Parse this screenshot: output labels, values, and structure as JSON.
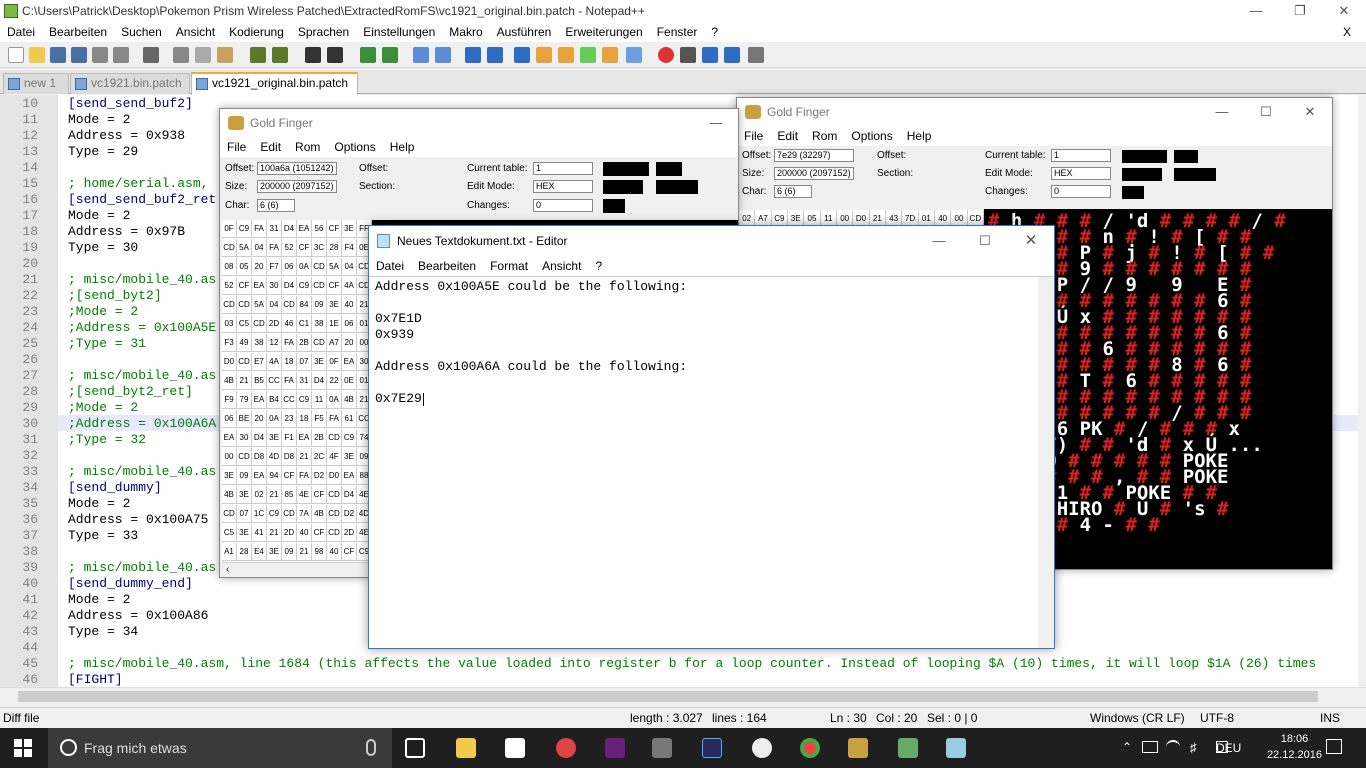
{
  "npp": {
    "title": "C:\\Users\\Patrick\\Desktop\\Pokemon Prism Wireless Patched\\ExtractedRomFS\\vc1921_original.bin.patch - Notepad++",
    "menu": [
      "Datei",
      "Bearbeiten",
      "Suchen",
      "Ansicht",
      "Kodierung",
      "Sprachen",
      "Einstellungen",
      "Makro",
      "Ausführen",
      "Erweiterungen",
      "Fenster",
      "?"
    ],
    "menu_close": "X",
    "tabs": [
      {
        "label": "new 1",
        "active": false
      },
      {
        "label": "vc1921.bin.patch",
        "active": false
      },
      {
        "label": "vc1921_original.bin.patch",
        "active": true
      }
    ],
    "lines": [
      {
        "n": "10",
        "t": "[send_send_buf2]",
        "k": "s"
      },
      {
        "n": "11",
        "t": "Mode = 2",
        "k": ""
      },
      {
        "n": "12",
        "t": "Address = 0x938",
        "k": ""
      },
      {
        "n": "13",
        "t": "Type = 29",
        "k": ""
      },
      {
        "n": "14",
        "t": "",
        "k": ""
      },
      {
        "n": "15",
        "t": "; home/serial.asm,",
        "k": "c"
      },
      {
        "n": "16",
        "t": "[send_send_buf2_ret",
        "k": "s"
      },
      {
        "n": "17",
        "t": "Mode = 2",
        "k": ""
      },
      {
        "n": "18",
        "t": "Address = 0x97B",
        "k": ""
      },
      {
        "n": "19",
        "t": "Type = 30",
        "k": ""
      },
      {
        "n": "20",
        "t": "",
        "k": ""
      },
      {
        "n": "21",
        "t": "; misc/mobile_40.as",
        "k": "c"
      },
      {
        "n": "22",
        "t": ";[send_byt2]",
        "k": "c"
      },
      {
        "n": "23",
        "t": ";Mode = 2",
        "k": "c"
      },
      {
        "n": "24",
        "t": ";Address = 0x100A5E",
        "k": "c"
      },
      {
        "n": "25",
        "t": ";Type = 31",
        "k": "c"
      },
      {
        "n": "26",
        "t": "",
        "k": ""
      },
      {
        "n": "27",
        "t": "; misc/mobile_40.as",
        "k": "c"
      },
      {
        "n": "28",
        "t": ";[send_byt2_ret]",
        "k": "c"
      },
      {
        "n": "29",
        "t": ";Mode = 2",
        "k": "c"
      },
      {
        "n": "30",
        "t": ";Address = 0x100A6A",
        "k": "c"
      },
      {
        "n": "31",
        "t": ";Type = 32",
        "k": "c"
      },
      {
        "n": "32",
        "t": "",
        "k": ""
      },
      {
        "n": "33",
        "t": "; misc/mobile_40.as",
        "k": "c"
      },
      {
        "n": "34",
        "t": "[send_dummy]",
        "k": "s"
      },
      {
        "n": "35",
        "t": "Mode = 2",
        "k": ""
      },
      {
        "n": "36",
        "t": "Address = 0x100A75",
        "k": ""
      },
      {
        "n": "37",
        "t": "Type = 33",
        "k": ""
      },
      {
        "n": "38",
        "t": "",
        "k": ""
      },
      {
        "n": "39",
        "t": "; misc/mobile_40.as",
        "k": "c"
      },
      {
        "n": "40",
        "t": "[send_dummy_end]",
        "k": "s"
      },
      {
        "n": "41",
        "t": "Mode = 2",
        "k": ""
      },
      {
        "n": "42",
        "t": "Address = 0x100A86",
        "k": ""
      },
      {
        "n": "43",
        "t": "Type = 34",
        "k": ""
      },
      {
        "n": "44",
        "t": "",
        "k": ""
      },
      {
        "n": "45",
        "t": "; misc/mobile_40.asm, line 1684 (this affects the value loaded into register b for a loop counter. Instead of looping $A (10) times, it will loop $1A (26) times",
        "k": "c"
      },
      {
        "n": "46",
        "t": "[FIGHT]",
        "k": "s"
      }
    ],
    "status": {
      "type": "Diff file",
      "length": "length : 3.027",
      "lines": "lines : 164",
      "ln": "Ln : 30",
      "col": "Col : 20",
      "sel": "Sel : 0 | 0",
      "eol": "Windows (CR LF)",
      "enc": "UTF-8",
      "mode": "INS"
    }
  },
  "gf1": {
    "title": "Gold Finger",
    "menu": [
      "File",
      "Edit",
      "Rom",
      "Options",
      "Help"
    ],
    "offset_label": "Offset:",
    "offset": "100a6a (1051242)",
    "offset2_label": "Offset:",
    "size_label": "Size:",
    "size": "200000 (2097152)",
    "section_label": "Section:",
    "char_label": "Char:",
    "char": "6 (6)",
    "table_label": "Current table:",
    "table": "1",
    "editmode_label": "Edit Mode:",
    "editmode": "HEX",
    "changes_label": "Changes:",
    "changes": "0",
    "hex": [
      [
        "0F",
        "C9",
        "FA",
        "31",
        "D4",
        "EA",
        "56",
        "CF",
        "3E",
        "FF"
      ],
      [
        "CD",
        "5A",
        "04",
        "FA",
        "52",
        "CF",
        "3C",
        "28",
        "F4",
        "0E"
      ],
      [
        "08",
        "05",
        "20",
        "F7",
        "06",
        "0A",
        "CD",
        "5A",
        "04",
        "CD"
      ],
      [
        "52",
        "CF",
        "EA",
        "30",
        "D4",
        "C9",
        "CD",
        "CF",
        "4A",
        "CD"
      ],
      [
        "CD",
        "CD",
        "5A",
        "04",
        "CD",
        "84",
        "09",
        "3E",
        "40",
        "21"
      ],
      [
        "03",
        "C5",
        "CD",
        "2D",
        "46",
        "C1",
        "38",
        "1E",
        "06",
        "01"
      ],
      [
        "F3",
        "49",
        "38",
        "12",
        "FA",
        "2B",
        "CD",
        "A7",
        "20",
        "00"
      ],
      [
        "D0",
        "CD",
        "E7",
        "4A",
        "18",
        "07",
        "3E",
        "0F",
        "EA",
        "30"
      ],
      [
        "4B",
        "21",
        "B5",
        "CC",
        "FA",
        "31",
        "D4",
        "22",
        "0E",
        "01"
      ],
      [
        "F9",
        "79",
        "EA",
        "B4",
        "CC",
        "C9",
        "11",
        "0A",
        "4B",
        "21"
      ],
      [
        "06",
        "BE",
        "20",
        "0A",
        "23",
        "18",
        "F5",
        "FA",
        "61",
        "CC"
      ],
      [
        "EA",
        "30",
        "D4",
        "3E",
        "F1",
        "EA",
        "2B",
        "CD",
        "C9",
        "74"
      ],
      [
        "00",
        "CD",
        "D8",
        "4D",
        "D8",
        "21",
        "2C",
        "4F",
        "3E",
        "09"
      ],
      [
        "3E",
        "09",
        "EA",
        "94",
        "CF",
        "FA",
        "D2",
        "D0",
        "EA",
        "88"
      ],
      [
        "4B",
        "3E",
        "02",
        "21",
        "85",
        "4E",
        "CF",
        "CD",
        "D4",
        "4E"
      ],
      [
        "CD",
        "07",
        "1C",
        "C9",
        "CD",
        "7A",
        "4B",
        "CD",
        "D2",
        "4D"
      ],
      [
        "C5",
        "3E",
        "41",
        "21",
        "2D",
        "40",
        "CF",
        "CD",
        "2D",
        "4E"
      ],
      [
        "A1",
        "28",
        "E4",
        "3E",
        "09",
        "21",
        "98",
        "40",
        "CF",
        "C9"
      ]
    ]
  },
  "gf2": {
    "title": "Gold Finger",
    "menu": [
      "File",
      "Edit",
      "Rom",
      "Options",
      "Help"
    ],
    "offset_label": "Offset:",
    "offset": "7e29 (32297)",
    "offset2_label": "Offset:",
    "size_label": "Size:",
    "size": "200000 (2097152)",
    "section_label": "Section:",
    "char_label": "Char:",
    "char": "6 (6)",
    "table_label": "Current table:",
    "table": "1",
    "editmode_label": "Edit Mode:",
    "editmode": "HEX",
    "changes_label": "Changes:",
    "changes": "0",
    "hex_row": [
      "02",
      "A7",
      "C9",
      "3E",
      "05",
      "11",
      "00",
      "D0",
      "21",
      "43",
      "7D",
      "01",
      "40",
      "00",
      "CD"
    ],
    "text_rows": [
      "# h # # # / 'd # # # # / #",
      "# # [ # # n # ! # [ # #",
      "# # # # P # j # ! # [ # #",
      "# # [ # 9 # # # # # # #",
      "# f # P / / 9   9   E #",
      "# # # # # # # # # # 6 #",
      "> # # Ú x # # # # # # #",
      "# # # # # # # # # # 6 #",
      "# # # # # 6 # # # # # #",
      "3 # # # # # # # 8 # 6 #",
      "# # # # T # 6 # # # # #",
      "# 6 # # # # # # # # # #",
      "# # # # # # # # / # # #",
      "# # # 6 PK # / # # # x",
      "# # (F) # # 'd # x Ú ...",
      "ı HIRO # # # # # POKE",
      "R0 # # # # , # # POKE",
      "# # # 1 # # POKE # #",
      "# 1 4 HIRO # Ú # 's #",
      "# h # # 4 - # #"
    ]
  },
  "notepad": {
    "title": "Neues Textdokument.txt - Editor",
    "menu": [
      "Datei",
      "Bearbeiten",
      "Format",
      "Ansicht",
      "?"
    ],
    "lines": [
      "Address 0x100A5E could be the following:",
      "",
      "0x7E1D",
      "0x939",
      "",
      "Address 0x100A6A could be the following:",
      "",
      "0x7E29"
    ]
  },
  "taskbar": {
    "search": "Frag mich etwas",
    "lang": "DEU",
    "time": "18:06",
    "date": "22.12.2016"
  }
}
